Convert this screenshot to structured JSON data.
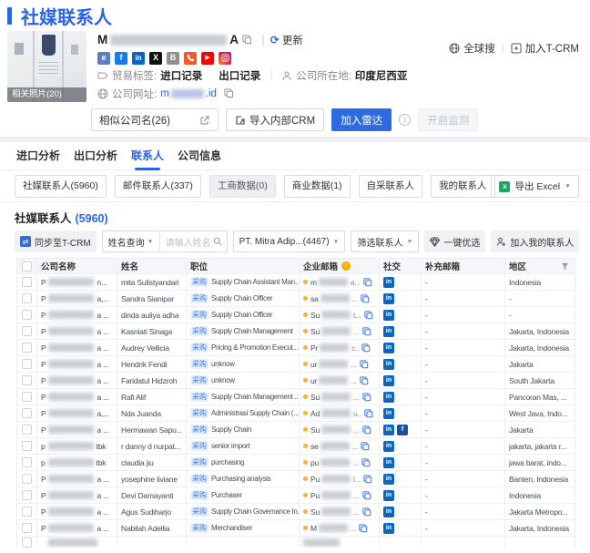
{
  "page_title": "社媒联系人",
  "header_links": {
    "global_search": "全球搜",
    "join_tcrm": "加入T-CRM"
  },
  "company": {
    "name_prefix": "M",
    "name_suffix": "A",
    "refresh_label": "更新",
    "photo_caption": "相关照片(20)",
    "social_icons": [
      "website",
      "facebook",
      "linkedin",
      "x",
      "blog",
      "phone",
      "youtube",
      "instagram"
    ],
    "trade_label": "贸易标签:",
    "trade_tags": [
      "进口记录",
      "出口记录"
    ],
    "location_label": "公司所在地:",
    "location_value": "印度尼西亚",
    "website_label": "公司网址:",
    "website_prefix": "m",
    "website_suffix": ".id",
    "similar_companies_label": "相似公司名(26)",
    "import_crm_label": "导入内部CRM",
    "join_radar_label": "加入雷达",
    "monitor_label": "开启监测"
  },
  "tabs": [
    {
      "label": "进口分析",
      "active": false
    },
    {
      "label": "出口分析",
      "active": false
    },
    {
      "label": "联系人",
      "active": true
    },
    {
      "label": "公司信息",
      "active": false
    }
  ],
  "pills": [
    {
      "label": "社媒联系人(5960)",
      "disabled": false
    },
    {
      "label": "邮件联系人(337)",
      "disabled": false
    },
    {
      "label": "工商数据(0)",
      "disabled": true
    },
    {
      "label": "商业数据(1)",
      "disabled": false
    },
    {
      "label": "自采联系人",
      "disabled": false
    },
    {
      "label": "我的联系人",
      "disabled": false
    }
  ],
  "export_label": "导出 Excel",
  "section": {
    "title": "社媒联系人",
    "count": "(5960)"
  },
  "toolbar": {
    "sync_label": "同步至T-CRM",
    "name_query_label": "姓名查询",
    "name_input_placeholder": "请输入姓名",
    "company_select_value": "PT. Mitra Adip...(4467)",
    "filter_label": "筛选联系人",
    "optimize_label": "一键优选",
    "add_my_contacts_label": "加入我的联系人"
  },
  "table": {
    "columns": [
      "公司名称",
      "姓名",
      "职位",
      "企业邮箱",
      "社交",
      "补充邮箱",
      "地区"
    ],
    "purchase_tag": "采购",
    "rows": [
      {
        "company_prefix": "P",
        "company_suffix": "n...",
        "name": "mita Sulistyandari",
        "position": "Supply Chain Assistant Man...",
        "email_prefix": "m",
        "email_suffix": "a...",
        "social": [
          "linkedin"
        ],
        "extra_email": "-",
        "region": "Indonesia"
      },
      {
        "company_prefix": "P",
        "company_suffix": "a,...",
        "name": "Sandra Sianipar",
        "position": "Supply Chain Officer",
        "email_prefix": "sa",
        "email_suffix": "...",
        "social": [
          "linkedin"
        ],
        "extra_email": "-",
        "region": "-"
      },
      {
        "company_prefix": "P",
        "company_suffix": "a ...",
        "name": "dinda auliya adha",
        "position": "Supply Chain Officer",
        "email_prefix": "Su",
        "email_suffix": "t...",
        "social": [
          "linkedin"
        ],
        "extra_email": "-",
        "region": "-"
      },
      {
        "company_prefix": "P",
        "company_suffix": "a ...",
        "name": "Kasniati Sinaga",
        "position": "Supply Chain Management",
        "email_prefix": "Su",
        "email_suffix": "...",
        "social": [
          "linkedin"
        ],
        "extra_email": "-",
        "region": "Jakarta, Indonesia"
      },
      {
        "company_prefix": "P",
        "company_suffix": "a ...",
        "name": "Audrey Vellicia",
        "position": "Pricing & Promotion Execut...",
        "email_prefix": "Pr",
        "email_suffix": "c..",
        "social": [
          "linkedin"
        ],
        "extra_email": "-",
        "region": "Jakarta, Indonesia"
      },
      {
        "company_prefix": "P",
        "company_suffix": "a ...",
        "name": "Hendrik Fendi",
        "position": "unknow",
        "email_prefix": "ur",
        "email_suffix": "...",
        "social": [
          "linkedin"
        ],
        "extra_email": "-",
        "region": "Jakarta"
      },
      {
        "company_prefix": "P",
        "company_suffix": "a ...",
        "name": "Faridatul Hidzroh",
        "position": "unknow",
        "email_prefix": "ur",
        "email_suffix": "...",
        "social": [
          "linkedin"
        ],
        "extra_email": "-",
        "region": "South Jakarta"
      },
      {
        "company_prefix": "P",
        "company_suffix": "a ...",
        "name": "Rafi Alif",
        "position": "Supply Chain Management ...",
        "email_prefix": "Su",
        "email_suffix": "...",
        "social": [
          "linkedin"
        ],
        "extra_email": "-",
        "region": "Pancoran Mas, ..."
      },
      {
        "company_prefix": "P",
        "company_suffix": "a,...",
        "name": "Nda Juanda",
        "position": "Administrasi Supply Chain (...",
        "email_prefix": "Ad",
        "email_suffix": "u..",
        "social": [
          "linkedin"
        ],
        "extra_email": "-",
        "region": "West Java, Indo..."
      },
      {
        "company_prefix": "P",
        "company_suffix": "a ...",
        "name": "Hermawan Sapu...",
        "position": "Supply Chain",
        "email_prefix": "Su",
        "email_suffix": "...",
        "social": [
          "linkedin",
          "facebook"
        ],
        "extra_email": "-",
        "region": "Jakarta"
      },
      {
        "company_prefix": "p",
        "company_suffix": "tbk",
        "name": "r danny d nurpat...",
        "position": "senior import",
        "email_prefix": "se",
        "email_suffix": "...",
        "social": [
          "linkedin"
        ],
        "extra_email": "-",
        "region": "jakarta, jakarta r..."
      },
      {
        "company_prefix": "p",
        "company_suffix": "tbk",
        "name": "claudia jiu",
        "position": "purchasing",
        "email_prefix": "pu",
        "email_suffix": "...",
        "social": [
          "linkedin"
        ],
        "extra_email": "-",
        "region": "jawa barat, indo..."
      },
      {
        "company_prefix": "P",
        "company_suffix": "a ...",
        "name": "yosephine liviane",
        "position": "Purchasing analysis",
        "email_prefix": "Pu",
        "email_suffix": "l...",
        "social": [
          "linkedin"
        ],
        "extra_email": "-",
        "region": "Banten, Indonesia"
      },
      {
        "company_prefix": "P",
        "company_suffix": "a ...",
        "name": "Devi Damayanti",
        "position": "Purchaser",
        "email_prefix": "Pu",
        "email_suffix": "...",
        "social": [
          "linkedin"
        ],
        "extra_email": "-",
        "region": "Indonesia"
      },
      {
        "company_prefix": "P",
        "company_suffix": "a ...",
        "name": "Agus Sudiharjo",
        "position": "Supply Chain Governance In...",
        "email_prefix": "Su",
        "email_suffix": "...",
        "social": [
          "linkedin"
        ],
        "extra_email": "-",
        "region": "Jakarta Metropo..."
      },
      {
        "company_prefix": "P",
        "company_suffix": "a ...",
        "name": "Nabilah Adellia",
        "position": "Merchandiser",
        "email_prefix": "M",
        "email_suffix": "...",
        "social": [
          "linkedin"
        ],
        "extra_email": "-",
        "region": "Jakarta, Indonesia"
      }
    ]
  },
  "colors": {
    "accent_blue": "#2b63e8",
    "button_blue": "#2e6ae1",
    "tag_blue_bg": "#e8f1fe",
    "linkedin_blue": "#0a66c2",
    "warn_orange": "#ffaa00"
  }
}
